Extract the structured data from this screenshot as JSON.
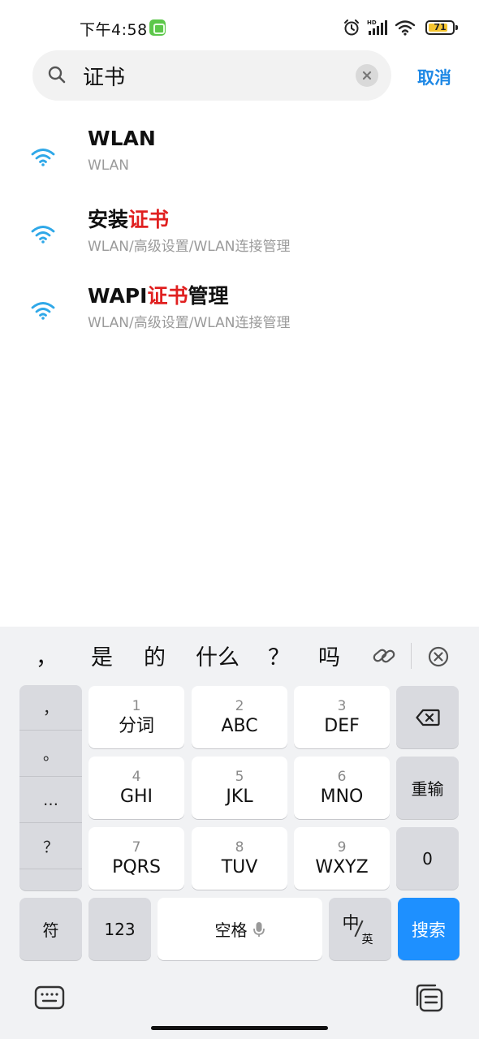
{
  "status": {
    "time": "下午4:58",
    "battery": "71"
  },
  "search": {
    "query": "证书",
    "placeholder": "",
    "cancel_label": "取消"
  },
  "results": [
    {
      "title_pre": "WLAN",
      "title_hl": "",
      "title_post": "",
      "path": "WLAN"
    },
    {
      "title_pre": "安装",
      "title_hl": "证书",
      "title_post": "",
      "path": "WLAN/高级设置/WLAN连接管理"
    },
    {
      "title_pre": "WAPI",
      "title_hl": "证书",
      "title_post": "管理",
      "path": "WLAN/高级设置/WLAN连接管理"
    }
  ],
  "keyboard": {
    "candidates": [
      "，",
      "是",
      "的",
      "什么",
      "？",
      "吗"
    ],
    "punct": [
      "，",
      "。",
      "…",
      "？"
    ],
    "keys": [
      {
        "num": "1",
        "letters": "分词"
      },
      {
        "num": "2",
        "letters": "ABC"
      },
      {
        "num": "3",
        "letters": "DEF"
      },
      {
        "num": "4",
        "letters": "GHI"
      },
      {
        "num": "5",
        "letters": "JKL"
      },
      {
        "num": "6",
        "letters": "MNO"
      },
      {
        "num": "7",
        "letters": "PQRS"
      },
      {
        "num": "8",
        "letters": "TUV"
      },
      {
        "num": "9",
        "letters": "WXYZ"
      }
    ],
    "reinput_label": "重输",
    "zero_label": "0",
    "symbol_label": "符",
    "numeric_label": "123",
    "space_label": "空格",
    "lang_main": "中",
    "lang_sub": "英",
    "search_label": "搜索"
  },
  "colors": {
    "accent": "#1e88e5",
    "highlight": "#e02020",
    "wifi": "#2fa8e8"
  }
}
